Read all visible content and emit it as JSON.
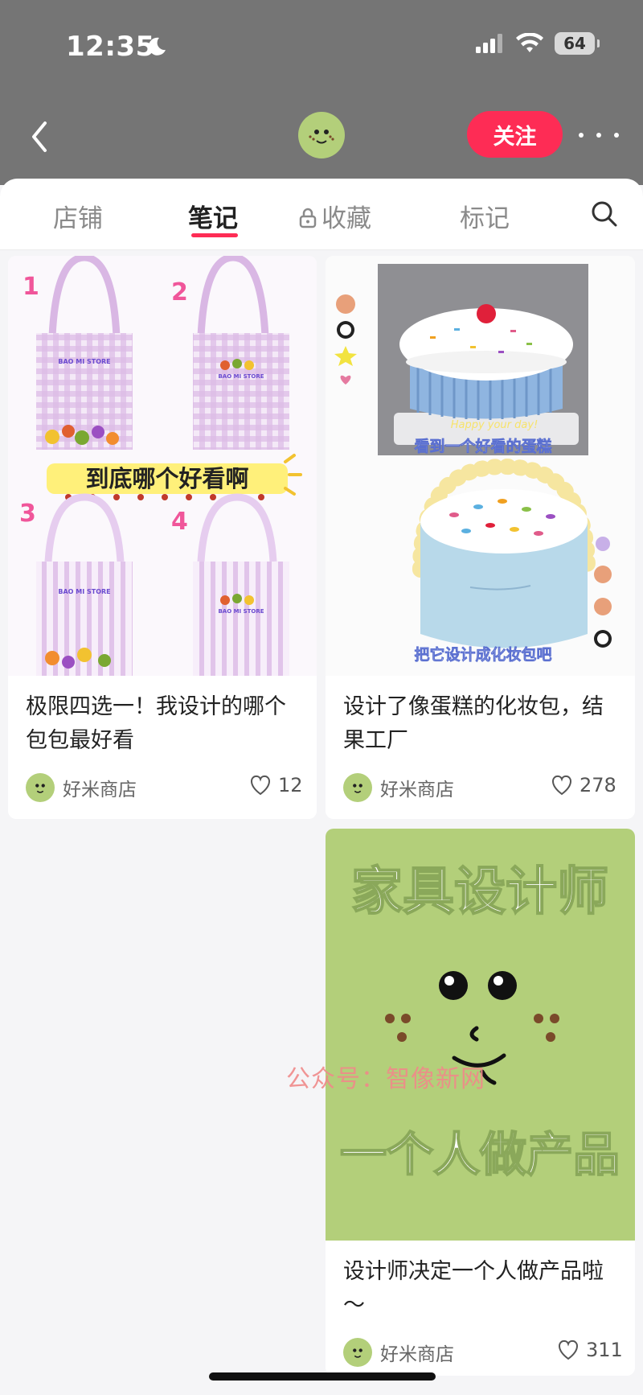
{
  "status": {
    "time": "12:35",
    "battery": "64"
  },
  "header": {
    "follow_label": "关注"
  },
  "tabs": [
    {
      "label": "店铺"
    },
    {
      "label": "笔记"
    },
    {
      "label": "收藏"
    },
    {
      "label": "标记"
    }
  ],
  "notes": [
    {
      "title": "极限四选一！我设计的哪个包包最好看",
      "author": "好米商店",
      "likes": "12",
      "image_text": {
        "banner": "到底哪个好看啊",
        "numbers": [
          "1",
          "2",
          "3",
          "4"
        ],
        "store": "BAO MI STORE"
      }
    },
    {
      "title": "设计了像蛋糕的化妆包，结果工厂",
      "author": "好米商店",
      "likes": "278",
      "image_text": {
        "caption_top": "看到一个好看的蛋糕",
        "caption_bottom": "把它设计成化妆包吧",
        "cake_text": "Happy your day!"
      }
    },
    {
      "title": "设计师决定一个人做产品啦～",
      "author": "好米商店",
      "likes": "311",
      "image_text": {
        "top": "家具设计师",
        "bottom": "一个人做产品"
      }
    }
  ],
  "watermark": "公众号：智像新网",
  "colors": {
    "accent": "#fe2c55",
    "avatar_green": "#b3cf7a",
    "topbar": "#757575"
  }
}
